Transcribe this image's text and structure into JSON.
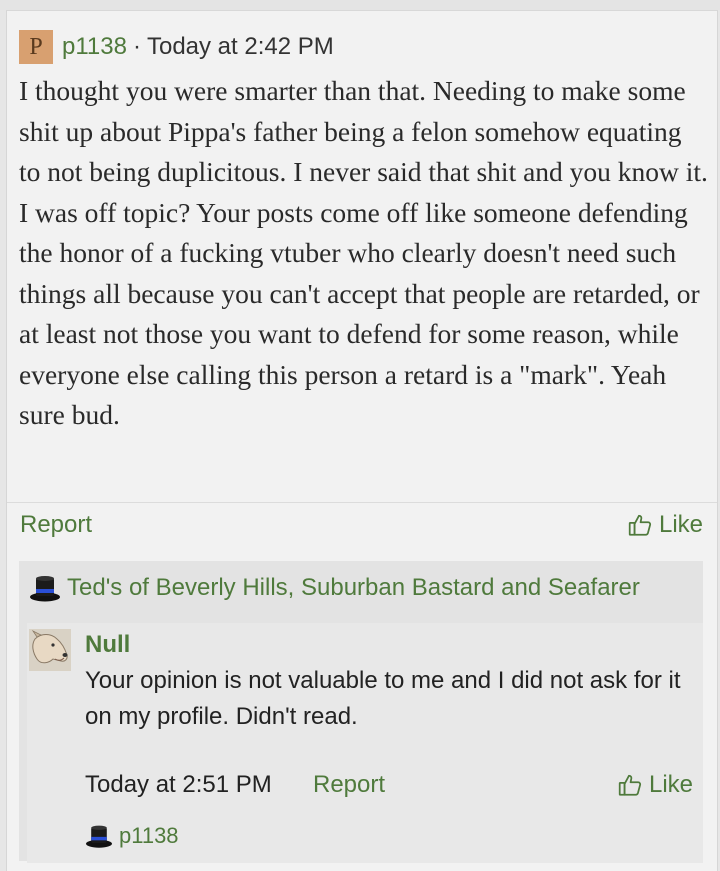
{
  "post": {
    "avatar_letter": "P",
    "username": "p1138",
    "separator": "·",
    "timestamp": "Today at 2:42 PM",
    "body": "I thought you were smarter than that. Needing to make some shit up about Pippa's father being a felon somehow equating to not being duplicitous. I never said that shit and you know it. I was off topic? Your posts come off like someone defending the honor of a fucking vtuber who clearly doesn't need such things all because you can't accept that people are retarded, or at least not those you want to defend for some reason, while everyone else calling this person a retard is a \"mark\". Yeah sure bud.",
    "report_label": "Report",
    "like_label": "Like"
  },
  "comments_section": {
    "group_icon": "top-hat-icon",
    "group_name": "Ted's of Beverly Hills, Suburban Bastard and Seafarer",
    "comment": {
      "avatar_icon": "dog-avatar",
      "author": "Null",
      "text": "Your opinion is not valuable to me and I did not ask for it on my profile. Didn't read.",
      "timestamp": "Today at 2:51 PM",
      "report_label": "Report",
      "like_label": "Like"
    },
    "reply_user": "p1138",
    "reply_icon": "top-hat-icon"
  },
  "colors": {
    "link_green": "#4f7a3c",
    "avatar_bg": "#d8a070"
  }
}
